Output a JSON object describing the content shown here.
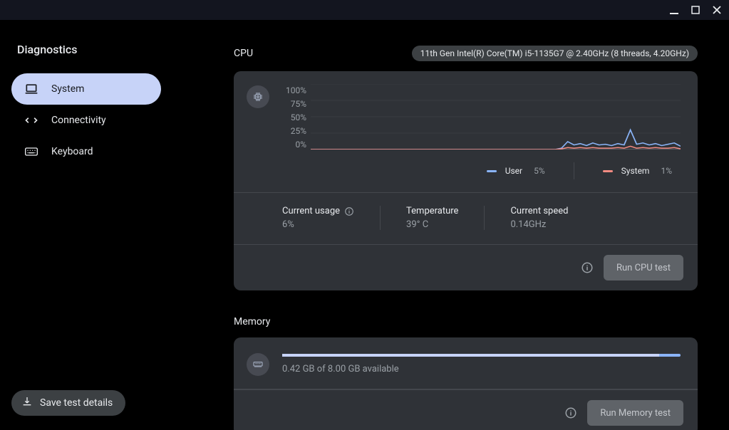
{
  "app": {
    "title": "Diagnostics"
  },
  "nav": {
    "system": "System",
    "connectivity": "Connectivity",
    "keyboard": "Keyboard"
  },
  "save_button": "Save test details",
  "cpu": {
    "title": "CPU",
    "model": "11th Gen Intel(R) Core(TM) i5-1135G7 @ 2.40GHz (8 threads, 4.20GHz)",
    "legend": {
      "user_label": "User",
      "user_value": "5%",
      "system_label": "System",
      "system_value": "1%"
    },
    "stats": {
      "usage_label": "Current usage",
      "usage_value": "6%",
      "temp_label": "Temperature",
      "temp_value": "39° C",
      "speed_label": "Current speed",
      "speed_value": "0.14GHz"
    },
    "action": "Run CPU test"
  },
  "memory": {
    "title": "Memory",
    "text": "0.42 GB of 8.00 GB available",
    "used_fraction": 0.947,
    "action": "Run Memory test"
  },
  "chart_data": {
    "type": "line",
    "ylim": [
      0,
      100
    ],
    "y_ticks": [
      "100%",
      "75%",
      "50%",
      "25%",
      "0%"
    ],
    "n_points": 60,
    "series": [
      {
        "name": "User",
        "color": "#8ab4f8",
        "values": [
          0,
          0,
          0,
          0,
          0,
          0,
          0,
          0,
          0,
          0,
          0,
          0,
          0,
          0,
          0,
          0,
          0,
          0,
          0,
          0,
          0,
          0,
          0,
          0,
          0,
          0,
          0,
          0,
          0,
          0,
          0,
          0,
          0,
          0,
          0,
          0,
          0,
          0,
          0,
          0,
          2,
          12,
          7,
          9,
          6,
          10,
          7,
          8,
          6,
          9,
          7,
          30,
          8,
          10,
          7,
          9,
          6,
          8,
          10,
          5
        ]
      },
      {
        "name": "System",
        "color": "#f28b82",
        "values": [
          0,
          0,
          0,
          0,
          0,
          0,
          0,
          0,
          0,
          0,
          0,
          0,
          0,
          0,
          0,
          0,
          0,
          0,
          0,
          0,
          0,
          0,
          0,
          0,
          0,
          0,
          0,
          0,
          0,
          0,
          0,
          0,
          0,
          0,
          0,
          0,
          0,
          0,
          0,
          0,
          1,
          3,
          2,
          3,
          2,
          3,
          2,
          2,
          2,
          3,
          2,
          5,
          2,
          3,
          2,
          3,
          2,
          2,
          3,
          1
        ]
      }
    ]
  }
}
